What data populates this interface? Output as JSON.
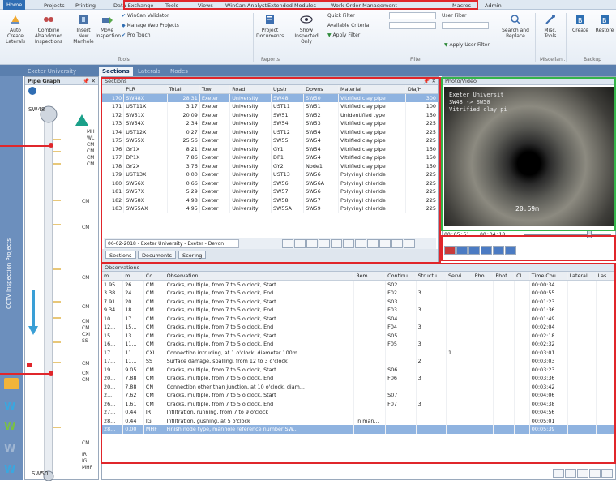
{
  "ribbon_tabs": [
    "Home",
    "Projects",
    "Printing",
    "Data Exchange",
    "Tools",
    "Views",
    "WinCan Analyst",
    "Extended Modules",
    "Work Order Management",
    "Macros",
    "Admin"
  ],
  "active_tab": "Home",
  "ribbon": {
    "buttons": [
      {
        "label": "Auto Create Laterals",
        "icon": "auto-create-icon"
      },
      {
        "label": "Combine Abandoned Inspections",
        "icon": "combine-icon"
      },
      {
        "label": "Insert New Manhole",
        "icon": "manhole-icon"
      },
      {
        "label": "Move Inspection",
        "icon": "move-icon"
      },
      {
        "label": "Project Documents",
        "icon": "documents-icon"
      },
      {
        "label": "Show Inspected Only",
        "icon": "eye-icon"
      },
      {
        "label": "Search and Replace",
        "icon": "search-replace-icon"
      },
      {
        "label": "Misc. Tools",
        "icon": "tools-icon"
      },
      {
        "label": "Create",
        "icon": "create-icon"
      },
      {
        "label": "Restore",
        "icon": "restore-icon"
      }
    ],
    "small_items": [
      "WinCan Validator",
      "Manage Web Projects",
      "Pro Touch"
    ],
    "filter_items": [
      "Quick Filter",
      "Available Criteria",
      "Apply Filter",
      "User Filter",
      "Apply User Filter"
    ],
    "groups": [
      "Tools",
      "Reports",
      "Filter",
      "Miscellan...",
      "Backup"
    ]
  },
  "doc_tabs": [
    "Exeter University",
    "Sections",
    "Laterals",
    "Nodes"
  ],
  "active_doc_tab": "Sections",
  "strip_label": "CCTV Inspection Projects",
  "pipe_graph": {
    "title": "Pipe Graph",
    "top_label": "SW48",
    "bottom_label": "SW50",
    "codes": [
      "MH",
      "WL",
      "CM",
      "CM",
      "CM",
      "CM",
      "CM",
      "CM",
      "CM",
      "CM",
      "CM",
      "CM",
      "CXI",
      "SS",
      "CM",
      "CM",
      "CN",
      "CM",
      "IR",
      "IG",
      "MHF"
    ]
  },
  "sections": {
    "title": "Sections",
    "columns": [
      "",
      "PLR",
      "Total",
      "Tow",
      "Road",
      "Upstr",
      "Downs",
      "Material",
      "Dia/H"
    ],
    "selected_index": 0,
    "rows": [
      [
        "170",
        "SW48X",
        "28.31",
        "Exeter",
        "University",
        "SW48",
        "SW50",
        "Vitrified clay pipe",
        "300"
      ],
      [
        "171",
        "UST11X",
        "3.17",
        "Exeter",
        "University",
        "UST11",
        "SW51",
        "Vitrified clay pipe",
        "100"
      ],
      [
        "172",
        "SW51X",
        "20.09",
        "Exeter",
        "University",
        "SW51",
        "SW52",
        "Unidentified type",
        "150"
      ],
      [
        "173",
        "SW54X",
        "2.34",
        "Exeter",
        "University",
        "SW54",
        "SW53",
        "Vitrified clay pipe",
        "225"
      ],
      [
        "174",
        "UST12X",
        "0.27",
        "Exeter",
        "University",
        "UST12",
        "SW54",
        "Vitrified clay pipe",
        "225"
      ],
      [
        "175",
        "SW55X",
        "25.56",
        "Exeter",
        "University",
        "SW55",
        "SW54",
        "Vitrified clay pipe",
        "225"
      ],
      [
        "176",
        "GY1X",
        "8.21",
        "Exeter",
        "University",
        "GY1",
        "SW54",
        "Vitrified clay pipe",
        "150"
      ],
      [
        "177",
        "DP1X",
        "7.86",
        "Exeter",
        "University",
        "DP1",
        "SW54",
        "Vitrified clay pipe",
        "150"
      ],
      [
        "178",
        "GY2X",
        "3.76",
        "Exeter",
        "University",
        "GY2",
        "Node1",
        "Vitrified clay pipe",
        "150"
      ],
      [
        "179",
        "UST13X",
        "0.00",
        "Exeter",
        "University",
        "UST13",
        "SW56",
        "Polyvinyl chloride",
        "225"
      ],
      [
        "180",
        "SW56X",
        "0.66",
        "Exeter",
        "University",
        "SW56",
        "SW56A",
        "Polyvinyl chloride",
        "225"
      ],
      [
        "181",
        "SW57X",
        "5.29",
        "Exeter",
        "University",
        "SW57",
        "SW56",
        "Polyvinyl chloride",
        "225"
      ],
      [
        "182",
        "SW58X",
        "4.98",
        "Exeter",
        "University",
        "SW58",
        "SW57",
        "Polyvinyl chloride",
        "225"
      ],
      [
        "183",
        "SW55AX",
        "4.95",
        "Exeter",
        "University",
        "SW55A",
        "SW59",
        "Polyvinyl chloride",
        "225"
      ]
    ],
    "footer_selector": "06-02-2018 - Exeter University - Exeter - Devon",
    "subtabs": [
      "Sections",
      "Documents",
      "Scoring"
    ]
  },
  "photo": {
    "title": "Photo/Video",
    "overlay_lines": [
      "Exeter Universit",
      "SW48 -> SW50",
      "Vitrified clay pi"
    ],
    "distance": "20.69m",
    "time_current": "00:05:51",
    "time_total": "00:04:18"
  },
  "observations": {
    "title": "Observations",
    "columns": [
      "m",
      "m",
      "Co",
      "Observation",
      "Rem",
      "Continu",
      "Structu",
      "Servi",
      "Pho",
      "Phot",
      "Cl",
      "Time Cou",
      "Lateral",
      "Las"
    ],
    "selected_index": 17,
    "rows": [
      [
        "1.95",
        "26...",
        "CM",
        "Cracks, multiple, from 7 to 5 o'clock, Start",
        "",
        "S02",
        "",
        "",
        "",
        "",
        "",
        "00:00:34",
        "",
        ""
      ],
      [
        "3.38",
        "24...",
        "CM",
        "Cracks, multiple, from 7 to 5 o'clock, End",
        "",
        "F02",
        "3",
        "",
        "",
        "",
        "",
        "00:00:55",
        "",
        ""
      ],
      [
        "7.91",
        "20...",
        "CM",
        "Cracks, multiple, from 7 to 5 o'clock, Start",
        "",
        "S03",
        "",
        "",
        "",
        "",
        "",
        "00:01:23",
        "",
        ""
      ],
      [
        "9.34",
        "18...",
        "CM",
        "Cracks, multiple, from 7 to 5 o'clock, End",
        "",
        "F03",
        "3",
        "",
        "",
        "",
        "",
        "00:01:36",
        "",
        ""
      ],
      [
        "10...",
        "17...",
        "CM",
        "Cracks, multiple, from 7 to 5 o'clock, Start",
        "",
        "S04",
        "",
        "",
        "",
        "",
        "",
        "00:01:49",
        "",
        ""
      ],
      [
        "12...",
        "15...",
        "CM",
        "Cracks, multiple, from 7 to 5 o'clock, End",
        "",
        "F04",
        "3",
        "",
        "",
        "",
        "",
        "00:02:04",
        "",
        ""
      ],
      [
        "15...",
        "13...",
        "CM",
        "Cracks, multiple, from 7 to 5 o'clock, Start",
        "",
        "S05",
        "",
        "",
        "",
        "",
        "",
        "00:02:18",
        "",
        ""
      ],
      [
        "16...",
        "11...",
        "CM",
        "Cracks, multiple, from 7 to 5 o'clock, End",
        "",
        "F05",
        "3",
        "",
        "",
        "",
        "",
        "00:02:32",
        "",
        ""
      ],
      [
        "17...",
        "11...",
        "CXI",
        "Connection intruding, at 1 o'clock, diameter 100m...",
        "",
        "",
        "",
        "1",
        "",
        "",
        "",
        "00:03:01",
        "",
        ""
      ],
      [
        "17...",
        "11...",
        "SS",
        "Surface damage, spalling, from 12 to 3 o'clock",
        "",
        "",
        "2",
        "",
        "",
        "",
        "",
        "00:03:03",
        "",
        ""
      ],
      [
        "19...",
        "9.05",
        "CM",
        "Cracks, multiple, from 7 to 5 o'clock, Start",
        "",
        "S06",
        "",
        "",
        "",
        "",
        "",
        "00:03:23",
        "",
        ""
      ],
      [
        "20...",
        "7.88",
        "CM",
        "Cracks, multiple, from 7 to 5 o'clock, End",
        "",
        "F06",
        "3",
        "",
        "",
        "",
        "",
        "00:03:36",
        "",
        ""
      ],
      [
        "20...",
        "7.88",
        "CN",
        "Connection other than junction, at 10 o'clock, diam...",
        "",
        "",
        "",
        "",
        "",
        "",
        "",
        "00:03:42",
        "",
        ""
      ],
      [
        "2...",
        "7.62",
        "CM",
        "Cracks, multiple, from 7 to 5 o'clock, Start",
        "",
        "S07",
        "",
        "",
        "",
        "",
        "",
        "00:04:06",
        "",
        ""
      ],
      [
        "26...",
        "1.61",
        "CM",
        "Cracks, multiple, from 7 to 5 o'clock, End",
        "",
        "F07",
        "3",
        "",
        "",
        "",
        "",
        "00:04:38",
        "",
        ""
      ],
      [
        "27...",
        "0.44",
        "IR",
        "Infiltration, running, from 7 to 9 o'clock",
        "",
        "",
        "",
        "",
        "",
        "",
        "",
        "00:04:56",
        "",
        ""
      ],
      [
        "28...",
        "0.44",
        "IG",
        "Infiltration, gushing, at 5 o'clock",
        "In man...",
        "",
        "",
        "",
        "",
        "",
        "",
        "00:05:01",
        "",
        ""
      ],
      [
        "28...",
        "0.00",
        "MHF",
        "Finish node type, manhole reference number SW...",
        "",
        "",
        "",
        "",
        "",
        "",
        "",
        "00:05:39",
        "",
        ""
      ]
    ]
  },
  "colors": {
    "accent": "#2f6db3",
    "highlight_red": "#e0262b",
    "highlight_green": "#34b44a",
    "selection": "#8fb3e0"
  }
}
